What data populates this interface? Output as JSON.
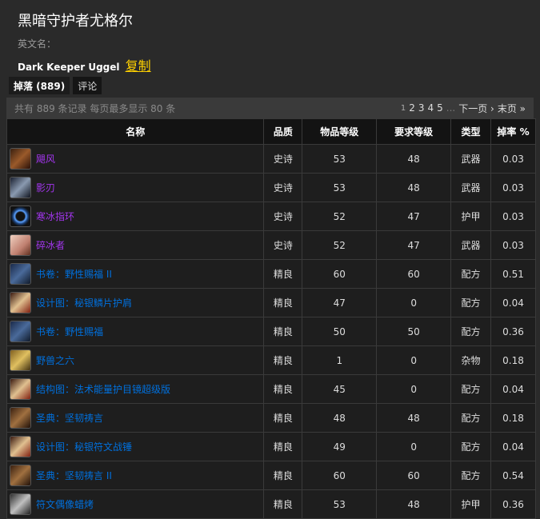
{
  "header": {
    "title": "黑暗守护者尤格尔",
    "en_label": "英文名：",
    "en_name": "Dark Keeper Uggel",
    "copy": "复制"
  },
  "tabs": [
    {
      "label": "掉落 (889)",
      "active": true
    },
    {
      "label": "评论",
      "active": false
    }
  ],
  "summary": {
    "text": "共有 889 条记录 每页最多显示 80 条",
    "current_page": "1",
    "pages": [
      "2",
      "3",
      "4",
      "5"
    ],
    "ellipsis": "...",
    "next": "下一页 ›",
    "last": "末页 »"
  },
  "columns": [
    "名称",
    "品质",
    "物品等级",
    "要求等级",
    "类型",
    "掉率 %"
  ],
  "rows": [
    {
      "name": "飓风",
      "quality": "史诗",
      "ilvl": "53",
      "req": "48",
      "type": "武器",
      "rate": "0.03",
      "q": "epic",
      "icon": "staff-icon",
      "ic": "ic-staff"
    },
    {
      "name": "影刃",
      "quality": "史诗",
      "ilvl": "53",
      "req": "48",
      "type": "武器",
      "rate": "0.03",
      "q": "epic",
      "icon": "blade-icon",
      "ic": "ic-blade"
    },
    {
      "name": "寒冰指环",
      "quality": "史诗",
      "ilvl": "52",
      "req": "47",
      "type": "护甲",
      "rate": "0.03",
      "q": "epic",
      "icon": "ring-icon",
      "ic": "ic-ring"
    },
    {
      "name": "碎冰者",
      "quality": "史诗",
      "ilvl": "52",
      "req": "47",
      "type": "武器",
      "rate": "0.03",
      "q": "epic",
      "icon": "hammer-icon",
      "ic": "ic-hammer"
    },
    {
      "name": "书卷：野性赐福 II",
      "quality": "精良",
      "ilvl": "60",
      "req": "60",
      "type": "配方",
      "rate": "0.51",
      "q": "rare",
      "icon": "book-icon",
      "ic": "ic-book"
    },
    {
      "name": "设计图：秘银鳞片护肩",
      "quality": "精良",
      "ilvl": "47",
      "req": "0",
      "type": "配方",
      "rate": "0.04",
      "q": "rare",
      "icon": "scroll-icon",
      "ic": "ic-scroll"
    },
    {
      "name": "书卷：野性赐福",
      "quality": "精良",
      "ilvl": "50",
      "req": "50",
      "type": "配方",
      "rate": "0.36",
      "q": "rare",
      "icon": "book-icon",
      "ic": "ic-book"
    },
    {
      "name": "野兽之六",
      "quality": "精良",
      "ilvl": "1",
      "req": "0",
      "type": "杂物",
      "rate": "0.18",
      "q": "rare",
      "icon": "card-icon",
      "ic": "ic-card"
    },
    {
      "name": "结构图：法术能量护目镜超级版",
      "quality": "精良",
      "ilvl": "45",
      "req": "0",
      "type": "配方",
      "rate": "0.04",
      "q": "rare",
      "icon": "scroll-icon",
      "ic": "ic-scroll"
    },
    {
      "name": "圣典：坚韧祷言",
      "quality": "精良",
      "ilvl": "48",
      "req": "48",
      "type": "配方",
      "rate": "0.18",
      "q": "rare",
      "icon": "tome-icon",
      "ic": "ic-tome"
    },
    {
      "name": "设计图：秘银符文战锤",
      "quality": "精良",
      "ilvl": "49",
      "req": "0",
      "type": "配方",
      "rate": "0.04",
      "q": "rare",
      "icon": "scroll-icon",
      "ic": "ic-scroll"
    },
    {
      "name": "圣典：坚韧祷言 II",
      "quality": "精良",
      "ilvl": "60",
      "req": "60",
      "type": "配方",
      "rate": "0.54",
      "q": "rare",
      "icon": "tome-icon",
      "ic": "ic-tome"
    },
    {
      "name": "符文偶像蜡烤",
      "quality": "精良",
      "ilvl": "53",
      "req": "48",
      "type": "护甲",
      "rate": "0.36",
      "q": "rare",
      "icon": "rune-icon",
      "ic": "ic-rune"
    }
  ],
  "colors": {
    "epic": "#a335ee",
    "rare": "#0070dd",
    "link": "#ffd100"
  }
}
